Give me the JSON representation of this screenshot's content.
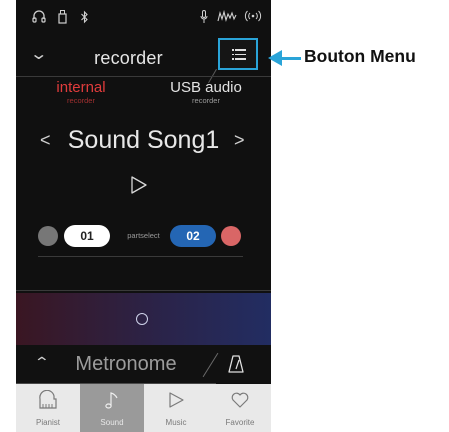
{
  "status_bar": {
    "icons": [
      "headphones-icon",
      "usb-memory-icon",
      "bluetooth-icon",
      "microphone-icon",
      "mixer-icon",
      "wireless-icon"
    ]
  },
  "header": {
    "title": "recorder",
    "menu_icon": "list-menu-icon"
  },
  "tabs": [
    {
      "label": "internal",
      "sub": "recorder",
      "active": true
    },
    {
      "label": "USB audio",
      "sub": "recorder",
      "active": false
    }
  ],
  "song": {
    "name": "Sound Song1",
    "prev": "<",
    "next": ">"
  },
  "parts": {
    "part1": "01",
    "part2": "02",
    "select_label": "partselect"
  },
  "metronome": {
    "label": "Metronome"
  },
  "bottom_nav": [
    {
      "label": "Pianist",
      "icon": "piano-icon",
      "active": false
    },
    {
      "label": "Sound",
      "icon": "music-note-icon",
      "active": true
    },
    {
      "label": "Music",
      "icon": "play-icon",
      "active": false
    },
    {
      "label": "Favorite",
      "icon": "heart-icon",
      "active": false
    }
  ],
  "callout": {
    "text": "Bouton Menu"
  },
  "colors": {
    "accent": "#2aa4d8",
    "internal_red": "#e03c3c",
    "part2_blue": "#2466b4"
  }
}
